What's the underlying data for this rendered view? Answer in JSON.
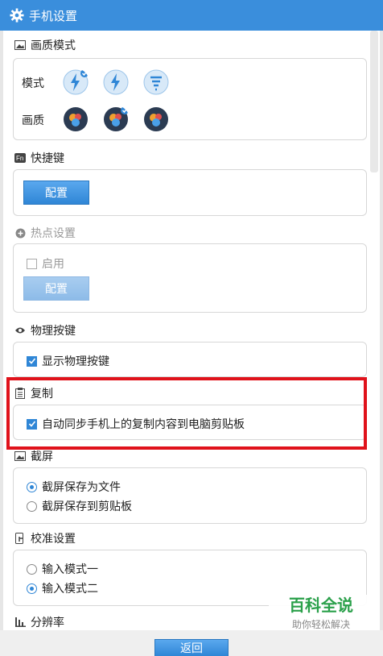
{
  "window": {
    "title": "手机设置"
  },
  "quality": {
    "section_title": "画质模式",
    "mode_label": "模式",
    "quality_label": "画质",
    "mode_icons": [
      "mode-1-icon",
      "mode-2-icon",
      "mode-3-icon"
    ],
    "quality_icons": [
      "quality-low-icon",
      "quality-mid-icon",
      "quality-high-icon"
    ]
  },
  "shortcut": {
    "section_title": "快捷键",
    "config_label": "配置"
  },
  "hotspot": {
    "section_title": "热点设置",
    "enable_label": "启用",
    "config_label": "配置"
  },
  "physical_keys": {
    "section_title": "物理按键",
    "show_label": "显示物理按键"
  },
  "copy": {
    "section_title": "复制",
    "sync_label": "自动同步手机上的复制内容到电脑剪贴板"
  },
  "screenshot": {
    "section_title": "截屏",
    "options": [
      "截屏保存为文件",
      "截屏保存到剪贴板"
    ]
  },
  "calibration": {
    "section_title": "校准设置",
    "options": [
      "输入模式一",
      "输入模式二"
    ]
  },
  "resolution": {
    "section_title": "分辨率"
  },
  "footer": {
    "back_label": "返回"
  },
  "watermark": {
    "line1": "百科全说",
    "line2": "助你轻松解决"
  },
  "colors": {
    "titlebar": "#3a8edc",
    "accent": "#2f86d6",
    "highlight": "#e0121b"
  }
}
